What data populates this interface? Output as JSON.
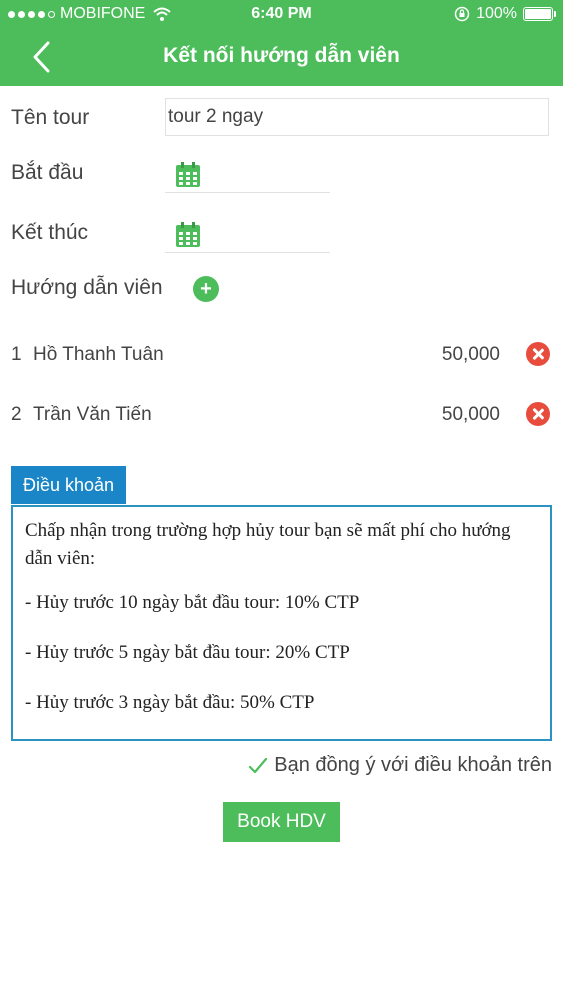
{
  "status_bar": {
    "carrier": "MOBIFONE",
    "time": "6:40 PM",
    "battery": "100%"
  },
  "header": {
    "title": "Kết nối hướng dẫn viên"
  },
  "form": {
    "tour_name_label": "Tên tour",
    "tour_name_value": "tour 2 ngay",
    "start_label": "Bắt đầu",
    "end_label": "Kết thúc",
    "guides_label": "Hướng dẫn viên"
  },
  "guides": [
    {
      "index": "1",
      "name": "Hồ Thanh Tuân",
      "price": "50,000"
    },
    {
      "index": "2",
      "name": "Trần Văn Tiến",
      "price": "50,000"
    }
  ],
  "terms": {
    "tab_label": "Điều khoản",
    "intro": "Chấp nhận trong trường hợp hủy tour bạn sẽ mất phí cho hướng dẫn viên:",
    "items": [
      "- Hủy trước 10 ngày bắt đầu tour: 10% CTP",
      "- Hủy trước 5 ngày bắt đầu tour: 20% CTP",
      "- Hủy trước 3 ngày bắt đầu: 50% CTP"
    ]
  },
  "agreement": {
    "label": "Bạn đồng ý với điều khoản trên",
    "checked": true
  },
  "book_button": {
    "label": "Book HDV"
  },
  "colors": {
    "primary": "#4cbd5a",
    "accent": "#1b86c7",
    "danger": "#e74c3c"
  }
}
